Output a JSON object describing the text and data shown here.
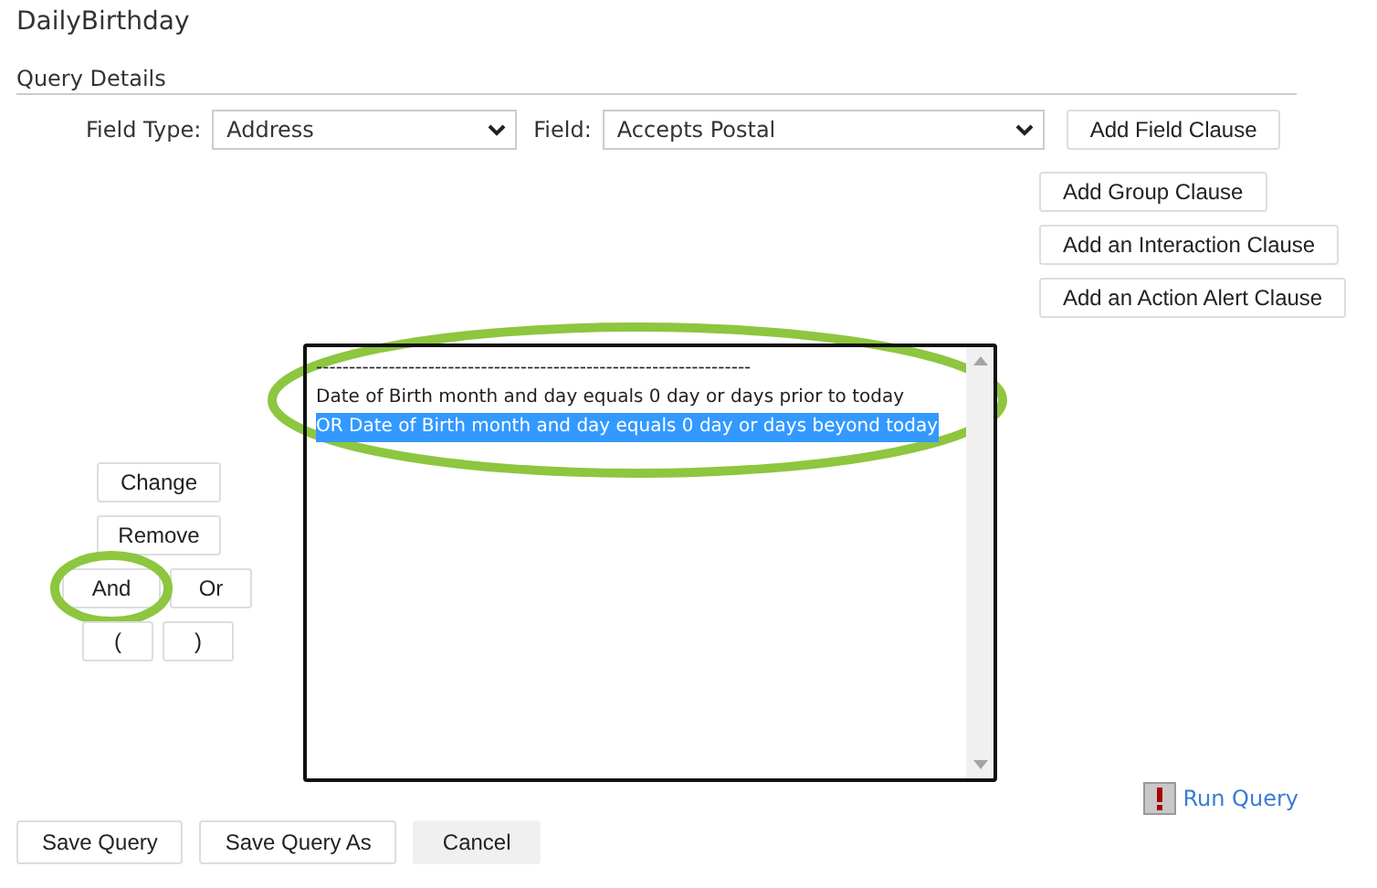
{
  "title": "DailyBirthday",
  "section": "Query Details",
  "field_type": {
    "label": "Field Type:",
    "value": "Address"
  },
  "field": {
    "label": "Field:",
    "value": "Accepts Postal"
  },
  "add_buttons": [
    "Add Field Clause",
    "Add Group Clause",
    "Add an Interaction Clause",
    "Add an Action Alert Clause"
  ],
  "query_lines": [
    {
      "text": "------------------------------------------------------------------",
      "selected": false
    },
    {
      "text": "Date of Birth month and day equals 0 day or days prior to today",
      "selected": false
    },
    {
      "text": "OR Date of Birth month and day equals 0 day or days beyond today",
      "selected": true
    }
  ],
  "query_lines_circled": true,
  "edit_buttons": [
    {
      "label": "Change",
      "circled": false
    },
    {
      "label": "Remove",
      "circled": false
    },
    {
      "label": "And",
      "circled": true
    },
    {
      "label": "Or",
      "circled": false
    },
    {
      "label": "(",
      "circled": false
    },
    {
      "label": ")",
      "circled": false
    }
  ],
  "run_query": "Run Query",
  "footer_buttons": [
    {
      "label": "Save Query",
      "kind": "outline"
    },
    {
      "label": "Save Query As",
      "kind": "outline"
    },
    {
      "label": "Cancel",
      "kind": "filled"
    }
  ]
}
